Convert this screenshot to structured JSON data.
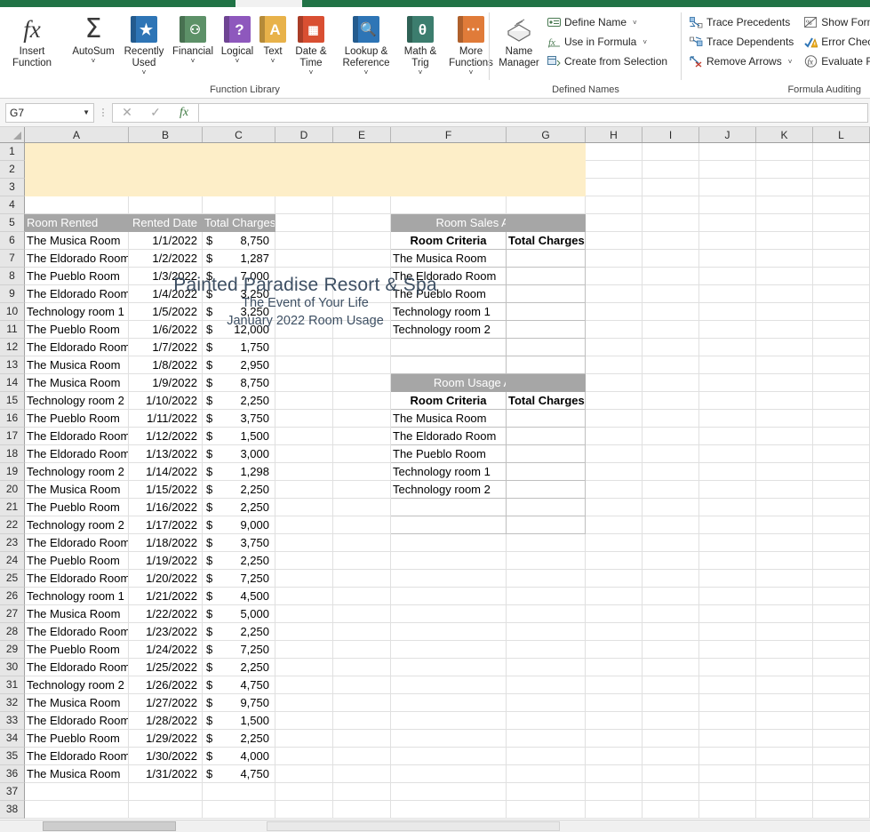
{
  "ribbon": {
    "groups": [
      {
        "name": "Function Library",
        "label": "Function Library",
        "buttons": [
          {
            "label": "Insert\nFunction",
            "icon": "fx-icon",
            "chevron": false
          },
          {
            "label": "AutoSum",
            "icon": "sigma-icon",
            "chevron": true
          },
          {
            "label": "Recently\nUsed",
            "icon": "star-book-icon",
            "chevron": true,
            "color": "#2e75b6",
            "glyph": "★"
          },
          {
            "label": "Financial",
            "icon": "coins-book-icon",
            "chevron": true,
            "color": "#4f8a5b",
            "glyph": "≋"
          },
          {
            "label": "Logical",
            "icon": "question-book-icon",
            "chevron": true,
            "color": "#7c49a8",
            "glyph": "?"
          },
          {
            "label": "Text",
            "icon": "letter-a-book-icon",
            "chevron": true,
            "color": "#e8b24a",
            "glyph": "A"
          },
          {
            "label": "Date &\nTime",
            "icon": "calendar-book-icon",
            "chevron": true,
            "color": "#d94f32",
            "glyph": "▦"
          },
          {
            "label": "Lookup &\nReference",
            "icon": "magnifier-book-icon",
            "chevron": true,
            "color": "#2e75b6",
            "glyph": "⌕"
          },
          {
            "label": "Math &\nTrig",
            "icon": "theta-book-icon",
            "chevron": true,
            "color": "#3c7d6e",
            "glyph": "θ"
          },
          {
            "label": "More\nFunctions",
            "icon": "ellipsis-book-icon",
            "chevron": true,
            "color": "#e07b39",
            "glyph": "…"
          }
        ]
      },
      {
        "name": "Defined Names",
        "label": "Defined Names",
        "big": {
          "label": "Name\nManager",
          "icon": "name-manager-icon"
        },
        "items": [
          {
            "label": "Define Name",
            "icon": "define-name-icon",
            "chevron": true
          },
          {
            "label": "Use in Formula",
            "icon": "use-in-formula-icon",
            "chevron": true
          },
          {
            "label": "Create from Selection",
            "icon": "create-from-selection-icon",
            "chevron": false
          }
        ]
      },
      {
        "name": "Formula Auditing",
        "label": "Formula Auditing",
        "col1": [
          {
            "label": "Trace Precedents",
            "icon": "trace-precedents-icon",
            "chevron": false
          },
          {
            "label": "Trace Dependents",
            "icon": "trace-dependents-icon",
            "chevron": false
          },
          {
            "label": "Remove Arrows",
            "icon": "remove-arrows-icon",
            "chevron": true
          }
        ],
        "col2": [
          {
            "label": "Show Form",
            "icon": "show-formulas-icon",
            "chevron": false
          },
          {
            "label": "Error Chec",
            "icon": "error-checking-icon",
            "chevron": false
          },
          {
            "label": "Evaluate F",
            "icon": "evaluate-formula-icon",
            "chevron": false
          }
        ]
      }
    ]
  },
  "formula_bar": {
    "name_box_value": "G7",
    "cancel_icon": "close-icon",
    "accept_icon": "check-icon",
    "function_icon": "fx-icon",
    "formula_value": "",
    "formula_placeholder": ""
  },
  "grid": {
    "column_headers": [
      "A",
      "B",
      "C",
      "D",
      "E",
      "F",
      "G",
      "H",
      "I",
      "J",
      "K",
      "L"
    ],
    "row_numbers": [
      1,
      2,
      3,
      4,
      5,
      6,
      7,
      8,
      9,
      10,
      11,
      12,
      13,
      14,
      15,
      16,
      17,
      18,
      19,
      20,
      21,
      22,
      23,
      24,
      25,
      26,
      27,
      28,
      29,
      30,
      31,
      32,
      33,
      34,
      35,
      36,
      37,
      38
    ]
  },
  "banner": {
    "line1": "Painted Paradise Resort & Spa",
    "line2": "The Event of Your Life",
    "line3": "January 2022 Room Usage",
    "fill_color": "#fdeec8",
    "text_color": "#3d4f63"
  },
  "table": {
    "headers": {
      "room_rented": "Room Rented",
      "rented_date": "Rented Date",
      "total_charges": "Total Charges"
    },
    "currency_symbol": "$",
    "rows": [
      {
        "room": "The Musica Room",
        "date": "1/1/2022",
        "charge": "8,750"
      },
      {
        "room": "The Eldorado Room",
        "date": "1/2/2022",
        "charge": "1,287"
      },
      {
        "room": "The Pueblo Room",
        "date": "1/3/2022",
        "charge": "7,000"
      },
      {
        "room": "The Eldorado Room",
        "date": "1/4/2022",
        "charge": "3,250"
      },
      {
        "room": "Technology room 1",
        "date": "1/5/2022",
        "charge": "3,250"
      },
      {
        "room": "The Pueblo Room",
        "date": "1/6/2022",
        "charge": "12,000"
      },
      {
        "room": "The Eldorado Room",
        "date": "1/7/2022",
        "charge": "1,750"
      },
      {
        "room": "The Musica Room",
        "date": "1/8/2022",
        "charge": "2,950"
      },
      {
        "room": "The Musica Room",
        "date": "1/9/2022",
        "charge": "8,750"
      },
      {
        "room": "Technology room 2",
        "date": "1/10/2022",
        "charge": "2,250"
      },
      {
        "room": "The Pueblo Room",
        "date": "1/11/2022",
        "charge": "3,750"
      },
      {
        "room": "The Eldorado Room",
        "date": "1/12/2022",
        "charge": "1,500"
      },
      {
        "room": "The Eldorado Room",
        "date": "1/13/2022",
        "charge": "3,000"
      },
      {
        "room": "Technology room 2",
        "date": "1/14/2022",
        "charge": "1,298"
      },
      {
        "room": "The Musica Room",
        "date": "1/15/2022",
        "charge": "2,250"
      },
      {
        "room": "The Pueblo Room",
        "date": "1/16/2022",
        "charge": "2,250"
      },
      {
        "room": "Technology room 2",
        "date": "1/17/2022",
        "charge": "9,000"
      },
      {
        "room": "The Eldorado Room",
        "date": "1/18/2022",
        "charge": "3,750"
      },
      {
        "room": "The Pueblo Room",
        "date": "1/19/2022",
        "charge": "2,250"
      },
      {
        "room": "The Eldorado Room",
        "date": "1/20/2022",
        "charge": "7,250"
      },
      {
        "room": "Technology room 1",
        "date": "1/21/2022",
        "charge": "4,500"
      },
      {
        "room": "The Musica Room",
        "date": "1/22/2022",
        "charge": "5,000"
      },
      {
        "room": "The Eldorado Room",
        "date": "1/23/2022",
        "charge": "2,250"
      },
      {
        "room": "The Pueblo Room",
        "date": "1/24/2022",
        "charge": "7,250"
      },
      {
        "room": "The Eldorado Room",
        "date": "1/25/2022",
        "charge": "2,250"
      },
      {
        "room": "Technology room 2",
        "date": "1/26/2022",
        "charge": "4,750"
      },
      {
        "room": "The Musica Room",
        "date": "1/27/2022",
        "charge": "9,750"
      },
      {
        "room": "The Eldorado Room",
        "date": "1/28/2022",
        "charge": "1,500"
      },
      {
        "room": "The Pueblo Room",
        "date": "1/29/2022",
        "charge": "2,250"
      },
      {
        "room": "The Eldorado Room",
        "date": "1/30/2022",
        "charge": "4,000"
      },
      {
        "room": "The Musica Room",
        "date": "1/31/2022",
        "charge": "4,750"
      }
    ]
  },
  "sales_analysis": {
    "title": "Room Sales Analysis",
    "col_criteria": "Room Criteria",
    "col_total": "Total Charges",
    "criteria": [
      "The Musica Room",
      "The Eldorado Room",
      "The Pueblo Room",
      "Technology room 1",
      "Technology room 2"
    ],
    "values": [
      "",
      "",
      "",
      "",
      ""
    ]
  },
  "usage_analysis": {
    "title": "Room Usage Analysis",
    "col_criteria": "Room Criteria",
    "col_total": "Total Charges",
    "criteria": [
      "The Musica Room",
      "The Eldorado Room",
      "The Pueblo Room",
      "Technology room 1",
      "Technology room 2"
    ],
    "values": [
      "",
      "",
      "",
      "",
      ""
    ]
  },
  "colors": {
    "ribbon_green": "#217346",
    "header_gray": "#a6a6a6",
    "banner_cream": "#fdeec8",
    "banner_text": "#3d4f63"
  }
}
